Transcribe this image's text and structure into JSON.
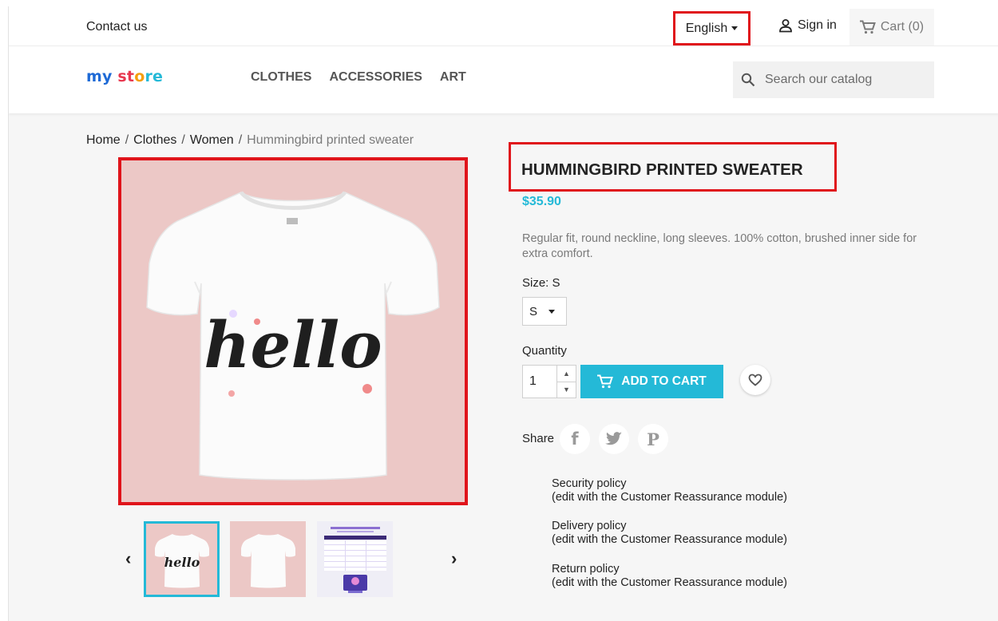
{
  "topbar": {
    "contact": "Contact us",
    "language": "English",
    "signin": "Sign in",
    "cart": "Cart (0)"
  },
  "header": {
    "logo_parts": [
      "my",
      " ",
      "st",
      "o",
      "re"
    ],
    "logo_colors": [
      "#1e6ad6",
      "#ffffff",
      "#e8384f",
      "#f59e0b",
      "#24b9d7"
    ],
    "nav": [
      "CLOTHES",
      "ACCESSORIES",
      "ART"
    ],
    "search_placeholder": "Search our catalog"
  },
  "breadcrumb": {
    "items": [
      "Home",
      "Clothes",
      "Women"
    ],
    "separator": "/",
    "current": "Hummingbird printed sweater"
  },
  "gallery": {
    "main_alt": "White t-shirt with hello print",
    "shirt_text": "hello",
    "thumb_texts": [
      "hello"
    ],
    "selected_index": 0,
    "thumb_count": 3
  },
  "product": {
    "title": "HUMMINGBIRD PRINTED SWEATER",
    "price": "$35.90",
    "description": "Regular fit, round neckline, long sleeves. 100% cotton, brushed inner side for extra comfort.",
    "size_label": "Size: S",
    "size_value": "S",
    "quantity_label": "Quantity",
    "quantity_value": "1",
    "add_to_cart": "ADD TO CART",
    "share_label": "Share"
  },
  "policies": [
    {
      "title": "Security policy",
      "note": "(edit with the Customer Reassurance module)"
    },
    {
      "title": "Delivery policy",
      "note": "(edit with the Customer Reassurance module)"
    },
    {
      "title": "Return policy",
      "note": "(edit with the Customer Reassurance module)"
    }
  ],
  "colors": {
    "accent": "#24b9d7",
    "highlight": "#e0141b",
    "image_bg": "#ecc8c6"
  }
}
